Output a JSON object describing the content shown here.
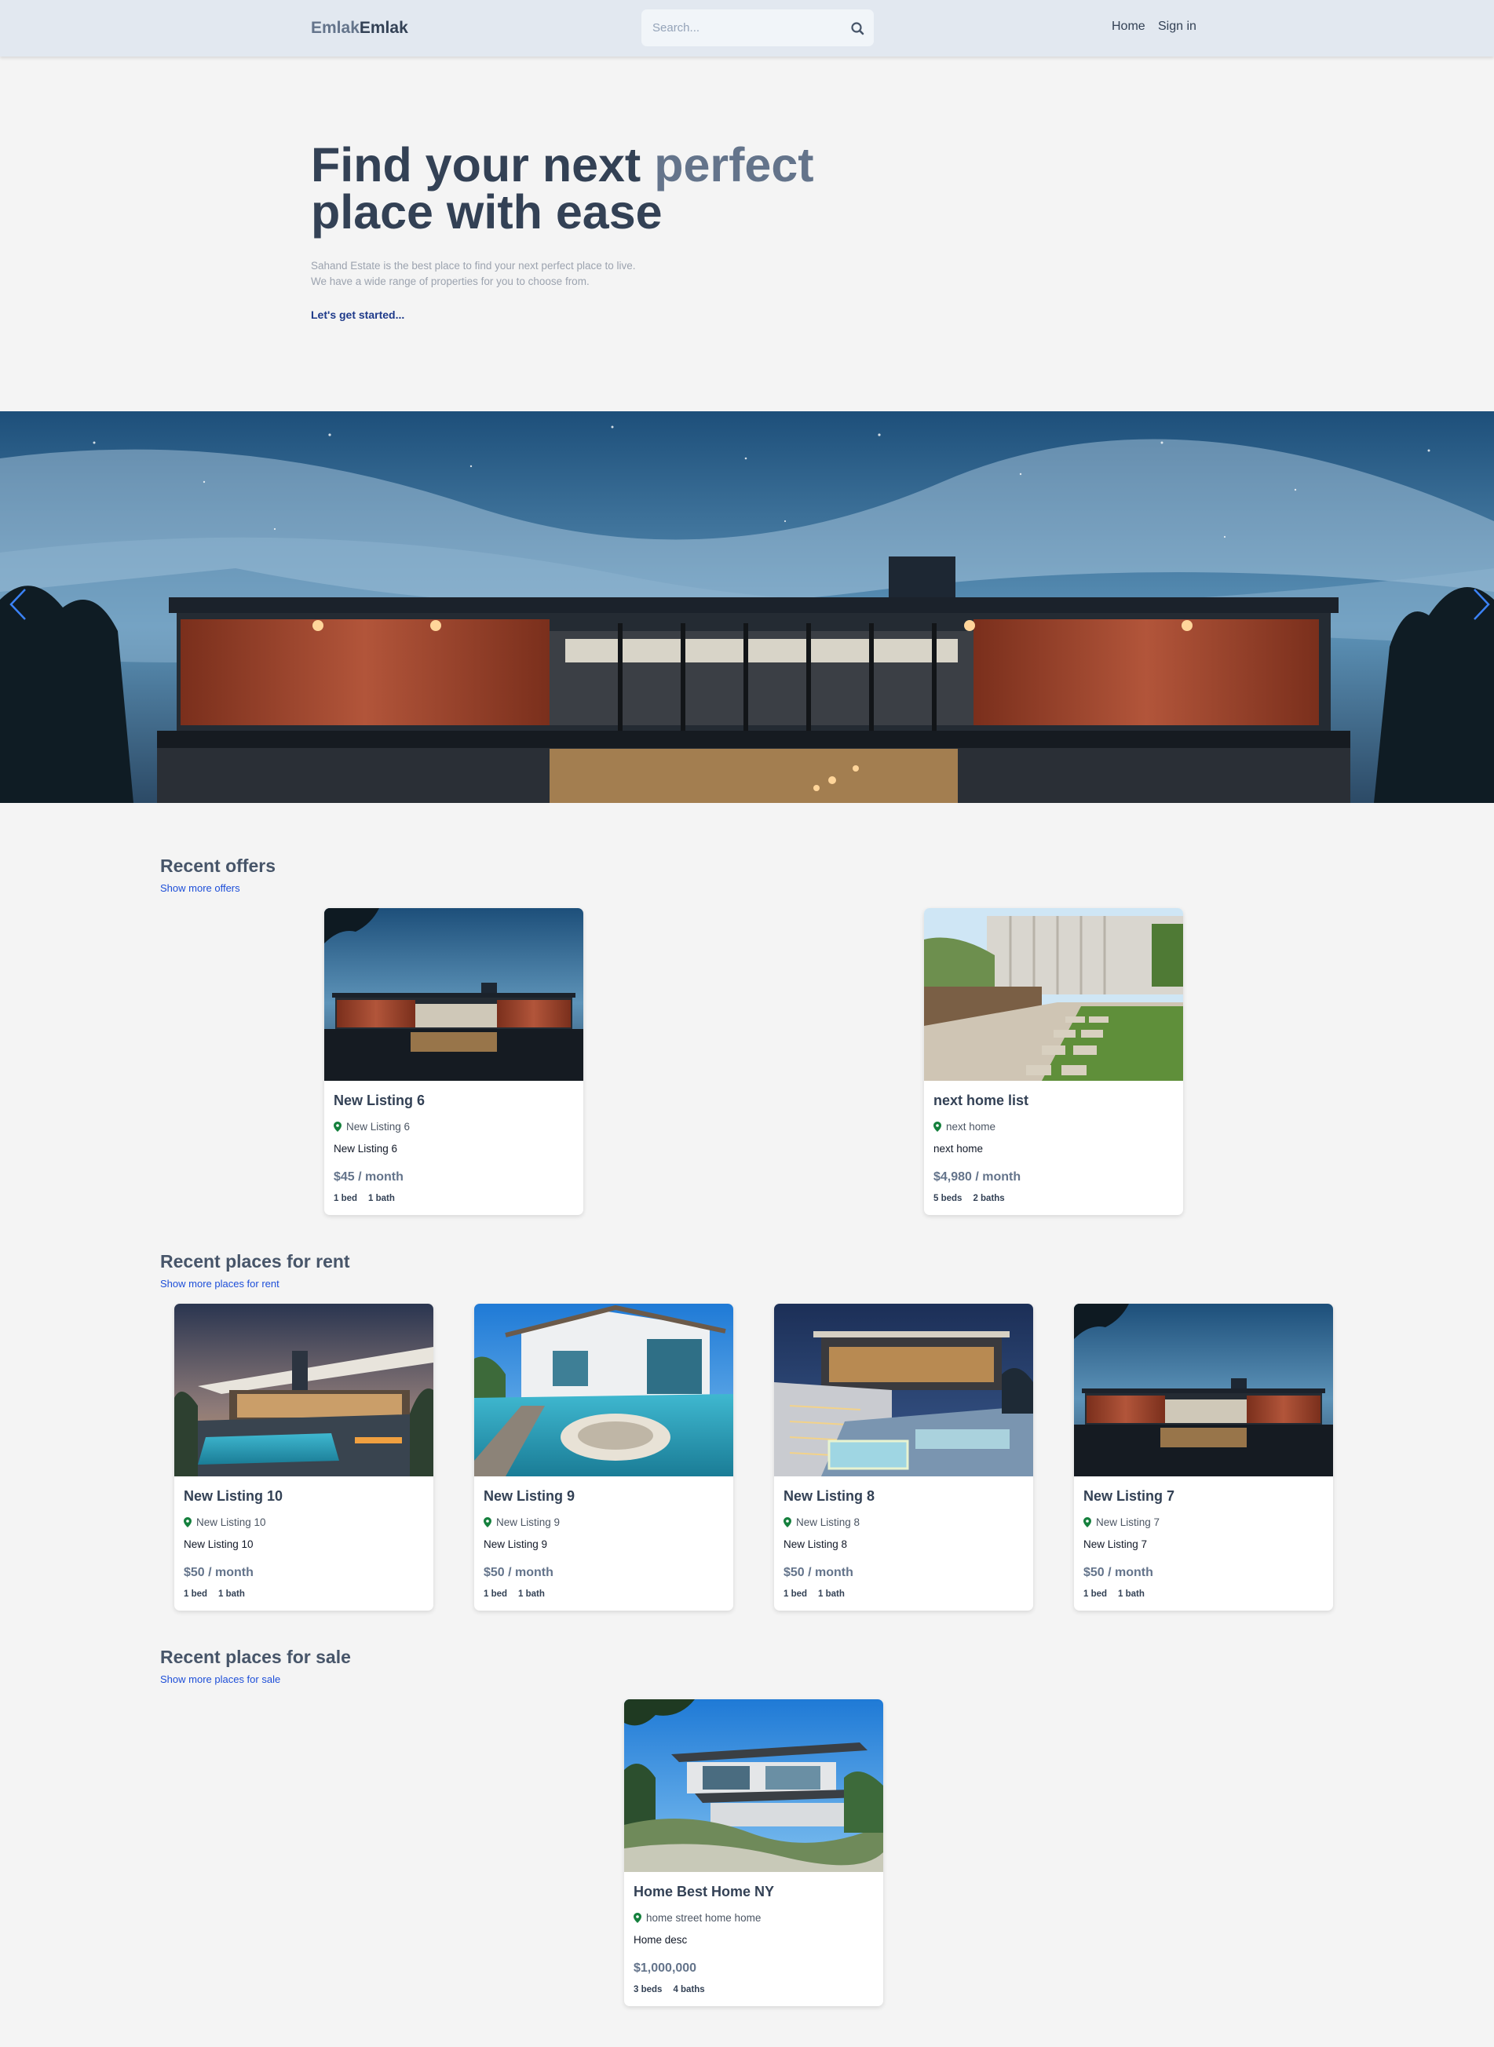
{
  "header": {
    "logo_part1": "Emlak",
    "logo_part2": "Emlak",
    "search_placeholder": "Search...",
    "search_icon": "magnifier-icon",
    "nav": {
      "home": "Home",
      "signin": "Sign in"
    }
  },
  "hero": {
    "title_part1": "Find your next ",
    "title_accent": "perfect",
    "title_part2": "place with ease",
    "subtitle_line1": "Sahand Estate is the best place to find your next perfect place to live.",
    "subtitle_line2": "We have a wide range of properties for you to choose from.",
    "cta": "Let's get started..."
  },
  "colors": {
    "accent": "#64748b",
    "text": "#334155",
    "link": "#1d4ed8",
    "cta": "#1e3a8a",
    "pin": "#15803d"
  },
  "sections": {
    "offers": {
      "title": "Recent offers",
      "link": "Show more offers",
      "listings": [
        {
          "title": "New Listing 6",
          "location": "New Listing 6",
          "description": "New Listing 6",
          "price": "$45 / month",
          "beds": "1 bed",
          "baths": "1 bath"
        },
        {
          "title": "next home list",
          "location": "next home",
          "description": "next home",
          "price": "$4,980 / month",
          "beds": "5 beds",
          "baths": "2 baths"
        }
      ]
    },
    "rent": {
      "title": "Recent places for rent",
      "link": "Show more places for rent",
      "listings": [
        {
          "title": "New Listing 10",
          "location": "New Listing 10",
          "description": "New Listing 10",
          "price": "$50 / month",
          "beds": "1 bed",
          "baths": "1 bath"
        },
        {
          "title": "New Listing 9",
          "location": "New Listing 9",
          "description": "New Listing 9",
          "price": "$50 / month",
          "beds": "1 bed",
          "baths": "1 bath"
        },
        {
          "title": "New Listing 8",
          "location": "New Listing 8",
          "description": "New Listing 8",
          "price": "$50 / month",
          "beds": "1 bed",
          "baths": "1 bath"
        },
        {
          "title": "New Listing 7",
          "location": "New Listing 7",
          "description": "New Listing 7",
          "price": "$50 / month",
          "beds": "1 bed",
          "baths": "1 bath"
        }
      ]
    },
    "sale": {
      "title": "Recent places for sale",
      "link": "Show more places for sale",
      "listings": [
        {
          "title": "Home Best Home NY",
          "location": "home street home home",
          "description": "Home desc",
          "price": "$1,000,000",
          "beds": "3 beds",
          "baths": "4 baths"
        }
      ]
    }
  }
}
